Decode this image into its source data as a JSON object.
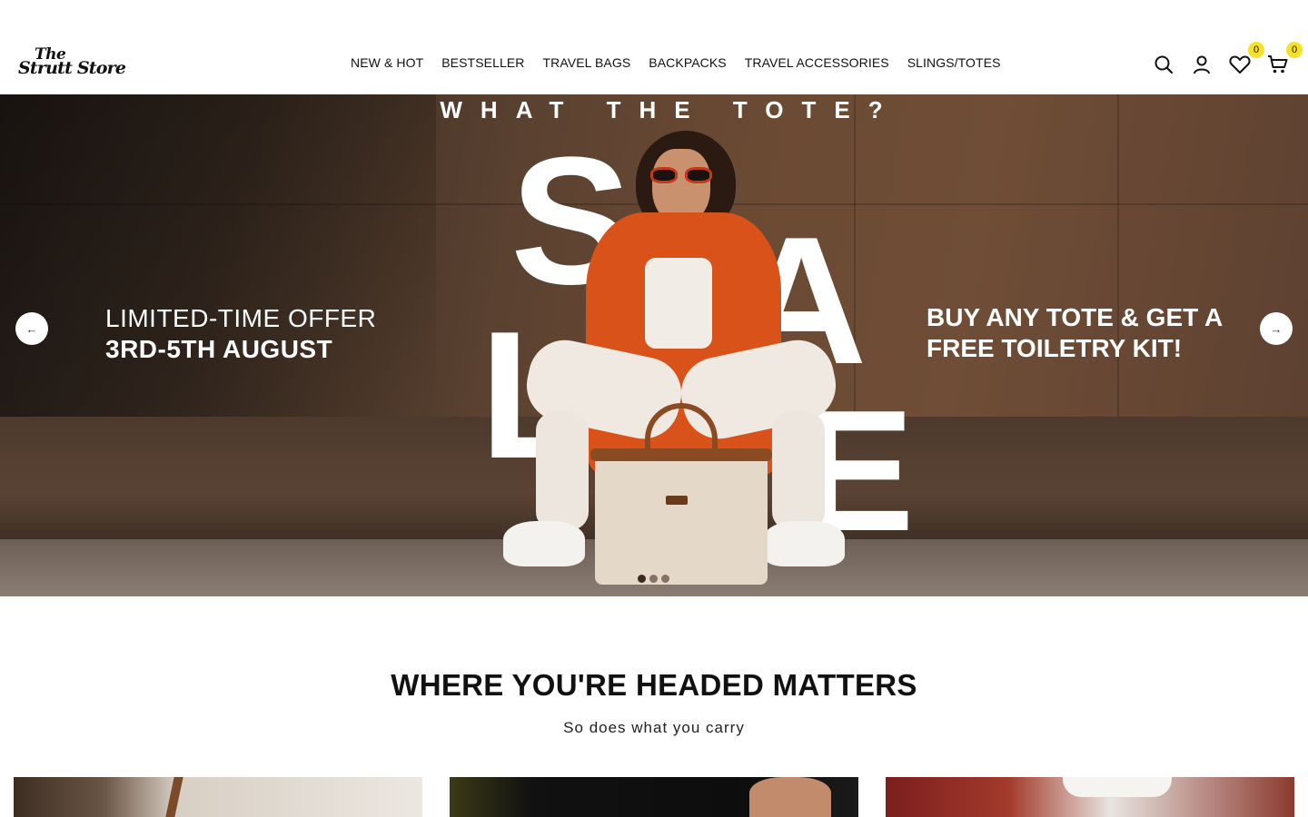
{
  "header": {
    "logo_top": "The",
    "logo_bottom": "Strutt Store",
    "nav": [
      "NEW & HOT",
      "BESTSELLER",
      "TRAVEL BAGS",
      "BACKPACKS",
      "TRAVEL ACCESSORIES",
      "SLINGS/TOTES"
    ],
    "icons": [
      "search-icon",
      "account-icon",
      "wishlist-icon",
      "cart-icon"
    ],
    "wishlist_count": "0",
    "cart_count": "0"
  },
  "hero": {
    "kicker": "WHAT THE TOTE?",
    "sale_letters": [
      "S",
      "A",
      "L",
      "E"
    ],
    "left_line1": "LIMITED-TIME OFFER",
    "left_line2": "3RD-5TH AUGUST",
    "right_line1": "BUY ANY TOTE & GET A",
    "right_line2": "FREE TOILETRY KIT!",
    "prev_label": "←",
    "next_label": "→",
    "slides": 3,
    "active_slide": 1
  },
  "section": {
    "title": "WHERE YOU'RE HEADED MATTERS",
    "subtitle": "So does what you carry"
  },
  "colors": {
    "badge": "#f5e12a",
    "jacket": "#d8521a"
  }
}
